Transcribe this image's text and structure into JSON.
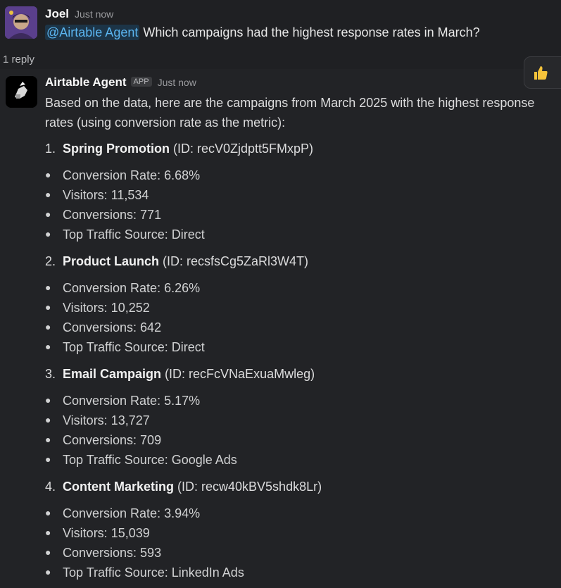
{
  "question": {
    "author": "Joel",
    "time": "Just now",
    "mention": "@Airtable Agent",
    "text": " Which campaigns had the highest response rates in March?",
    "reply_count": "1 reply"
  },
  "answer": {
    "author": "Airtable Agent",
    "badge": "APP",
    "time": "Just now",
    "reaction": "thumbs-up-icon",
    "intro": "Based on the data, here are the campaigns from March 2025 with the highest response rates (using conversion rate as the metric):",
    "campaigns": [
      {
        "num": "1.",
        "name": "Spring Promotion",
        "id": " (ID: recV0Zjdptt5FMxpP)",
        "stats": [
          "Conversion Rate: 6.68%",
          "Visitors: 11,534",
          "Conversions: 771",
          "Top Traffic Source: Direct"
        ]
      },
      {
        "num": "2.",
        "name": "Product Launch",
        "id": " (ID: recsfsCg5ZaRl3W4T)",
        "stats": [
          "Conversion Rate: 6.26%",
          "Visitors: 10,252",
          "Conversions: 642",
          "Top Traffic Source: Direct"
        ]
      },
      {
        "num": "3.",
        "name": "Email Campaign",
        "id": " (ID: recFcVNaExuaMwleg)",
        "stats": [
          "Conversion Rate: 5.17%",
          "Visitors: 13,727",
          "Conversions: 709",
          "Top Traffic Source: Google Ads"
        ]
      },
      {
        "num": "4.",
        "name": "Content Marketing",
        "id": " (ID: recw40kBV5shdk8Lr)",
        "stats": [
          "Conversion Rate: 3.94%",
          "Visitors: 15,039",
          "Conversions: 593",
          "Top Traffic Source: LinkedIn Ads"
        ]
      }
    ]
  }
}
